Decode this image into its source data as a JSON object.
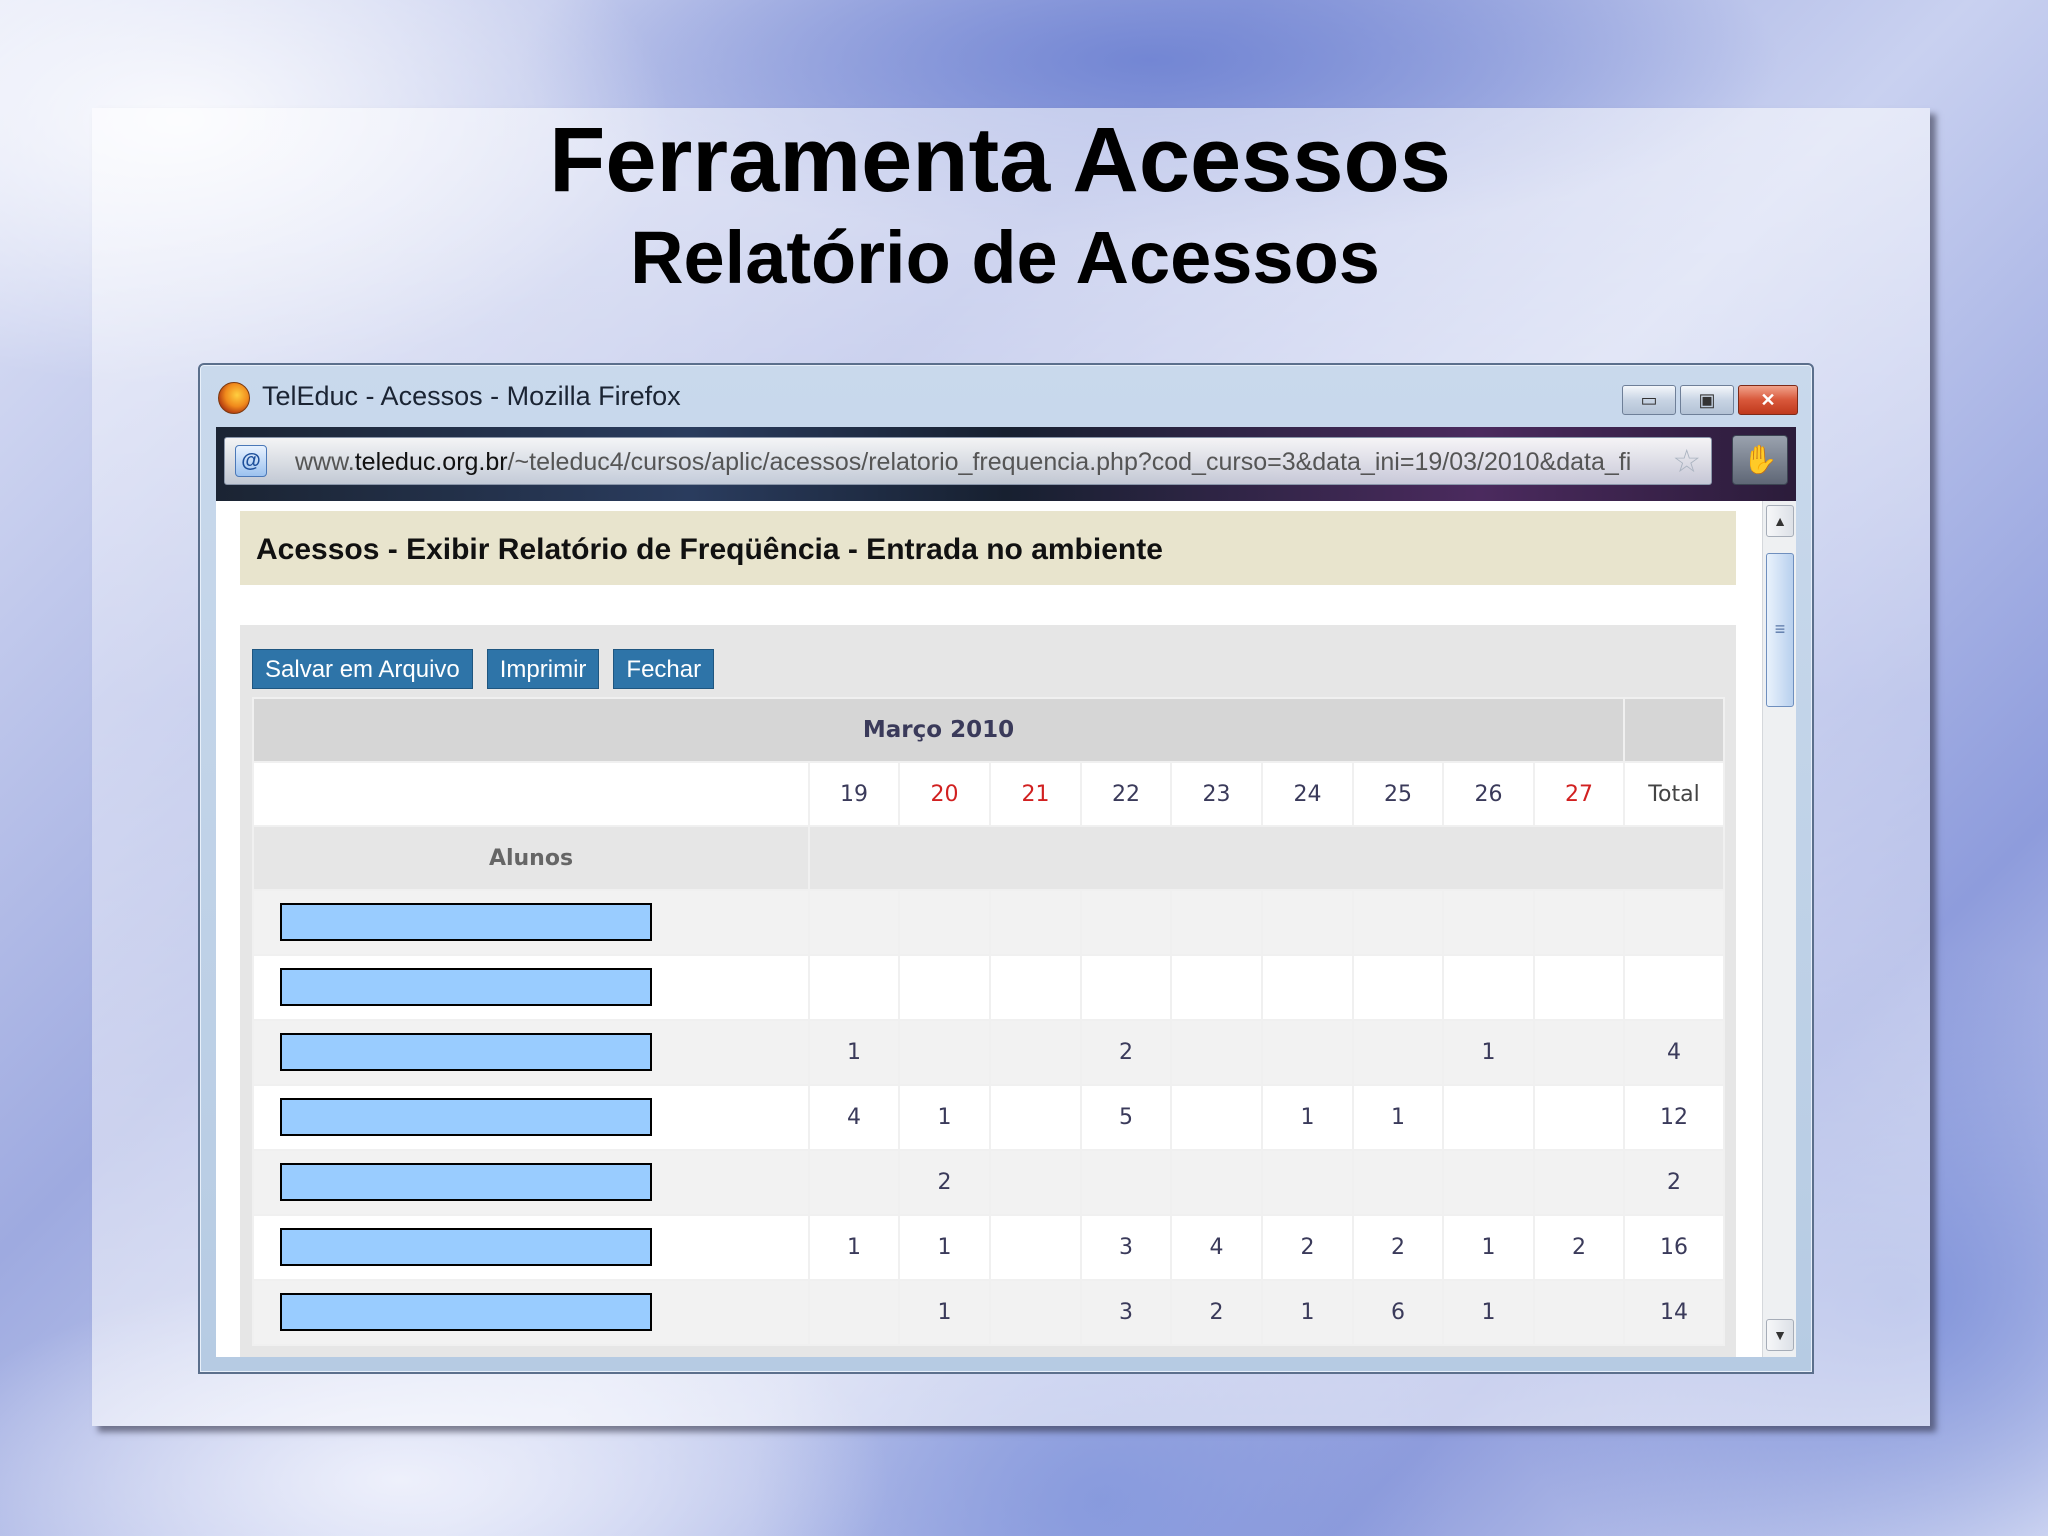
{
  "slide": {
    "title": "Ferramenta Acessos",
    "subtitle": "Relatório de Acessos"
  },
  "browser": {
    "window_title": "TelEduc - Acessos - Mozilla Firefox",
    "url_prefix": "www.",
    "url_domain": "teleduc.org.br",
    "url_path": "/~teleduc4/cursos/aplic/acessos/relatorio_frequencia.php?cod_curso=3&data_ini=19/03/2010&data_fi",
    "buttons": {
      "minimize": "▭",
      "maximize": "▣",
      "close": "✕"
    }
  },
  "page": {
    "heading": "Acessos - Exibir Relatório de Freqüência - Entrada no ambiente",
    "actions": [
      "Salvar em Arquivo",
      "Imprimir",
      "Fechar"
    ]
  },
  "report": {
    "month": "Março 2010",
    "days": [
      "19",
      "20",
      "21",
      "22",
      "23",
      "24",
      "25",
      "26",
      "27"
    ],
    "weekend_days": [
      "20",
      "21",
      "27"
    ],
    "total_label": "Total",
    "students_label": "Alunos",
    "rows": [
      [
        "",
        "",
        "",
        "",
        "",
        "",
        "",
        "",
        "",
        ""
      ],
      [
        "",
        "",
        "",
        "",
        "",
        "",
        "",
        "",
        "",
        ""
      ],
      [
        "1",
        "",
        "",
        "2",
        "",
        "",
        "",
        "1",
        "",
        "4"
      ],
      [
        "4",
        "1",
        "",
        "5",
        "",
        "1",
        "1",
        "",
        "",
        "12"
      ],
      [
        "",
        "2",
        "",
        "",
        "",
        "",
        "",
        "",
        "",
        "2"
      ],
      [
        "1",
        "1",
        "",
        "3",
        "4",
        "2",
        "2",
        "1",
        "2",
        "16"
      ],
      [
        "",
        "1",
        "",
        "3",
        "2",
        "1",
        "6",
        "1",
        "",
        "14"
      ]
    ]
  },
  "colors": {
    "button_bg": "#2e74a8",
    "header_bg": "#e8e4cd",
    "weekend_text": "#d12020",
    "day_text": "#3a6ea5",
    "redaction": "#99ccff"
  }
}
